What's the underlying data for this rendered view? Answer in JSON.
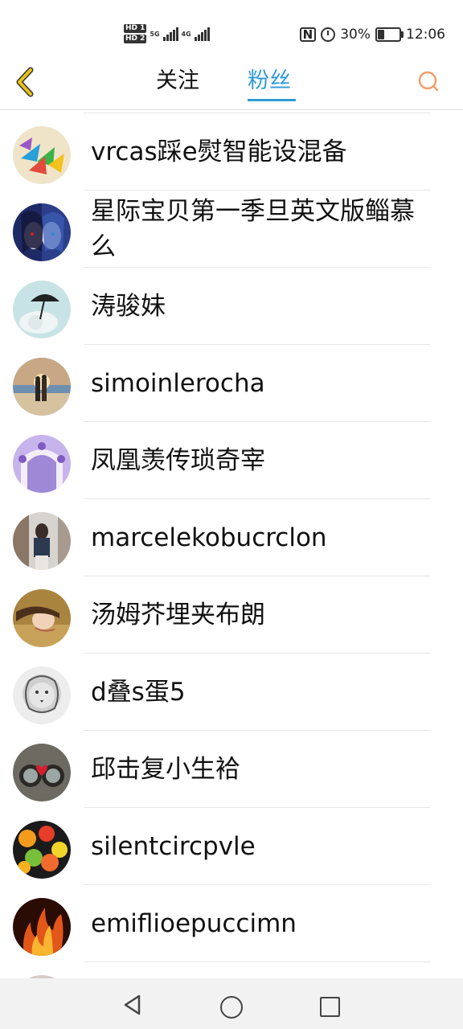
{
  "status_bar": {
    "hd1": "HD 1",
    "hd2": "HD 2",
    "net1": "5G",
    "net2": "4G",
    "nfc": "N",
    "battery": "30%",
    "battery_level": 0.3,
    "time": "12:06"
  },
  "header": {
    "tabs": [
      {
        "label": "关注",
        "active": false
      },
      {
        "label": "粉丝",
        "active": true
      }
    ],
    "accent_color": "#2f9bd6",
    "back_icon_color": "#e8c21a",
    "search_icon_color": "#f29b6a"
  },
  "fans": [
    {
      "name": "vrcas踩e熨智能设混备",
      "avatar": "avatar-paper-cranes"
    },
    {
      "name": "星际宝贝第一季旦英文版鲻慕么",
      "avatar": "avatar-anime-duo"
    },
    {
      "name": "涛骏妹",
      "avatar": "avatar-umbrella-rose"
    },
    {
      "name": "simoinlerocha",
      "avatar": "avatar-couple-sunset"
    },
    {
      "name": "凤凰羡传琐奇宰",
      "avatar": "avatar-wedding-arch"
    },
    {
      "name": "marcelekobucrclon",
      "avatar": "avatar-girl-street"
    },
    {
      "name": "汤姆芥埋夹布朗",
      "avatar": "avatar-girl-lying"
    },
    {
      "name": "d叠s蛋5",
      "avatar": "avatar-lion-sketch"
    },
    {
      "name": "邱击复小生袷",
      "avatar": "avatar-heart-goggles"
    },
    {
      "name": "silentcircpvle",
      "avatar": "avatar-citrus-fruits"
    },
    {
      "name": "emiflioepuccimn",
      "avatar": "avatar-fire"
    }
  ]
}
